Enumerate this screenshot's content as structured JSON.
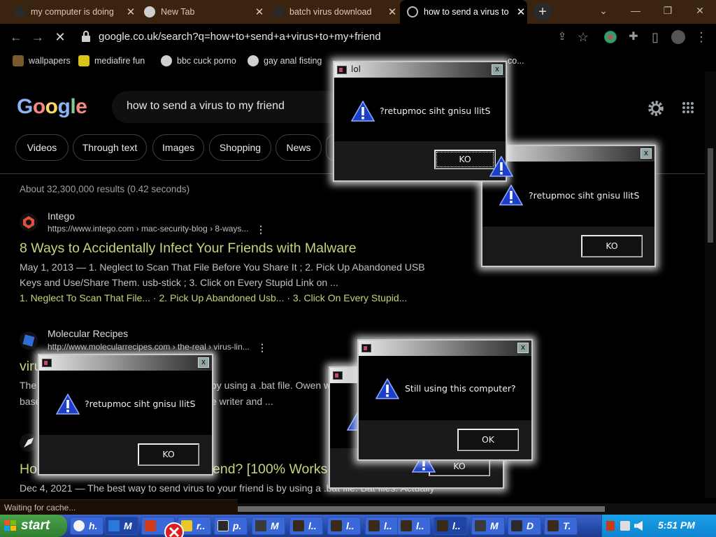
{
  "browser": {
    "tabs": [
      {
        "title": "my computer is doing",
        "close": "✕"
      },
      {
        "title": "New Tab",
        "close": "✕"
      },
      {
        "title": "batch virus download",
        "close": "✕"
      },
      {
        "title": "how to send a virus to",
        "close": "✕",
        "active": true
      }
    ],
    "new_tab": "+",
    "window_controls": {
      "tabsearch": "⌄",
      "minimize": "—",
      "restore": "❐",
      "close": "✕"
    },
    "nav": {
      "back": "←",
      "forward": "→",
      "reload": "✕",
      "share": "⇪",
      "star": "☆",
      "extensions": "✚",
      "sidebar": "▯",
      "menu": "⋮"
    },
    "url": "google.co.uk/search?q=how+to+send+a+virus+to+my+friend",
    "bookmarks": [
      {
        "label": "wallpapers",
        "color": "#7a5a2a"
      },
      {
        "label": "mediafire fun",
        "color": "#d8c31c"
      },
      {
        "label": "bbc cuck porno",
        "color": "#cfcfcf"
      },
      {
        "label": "gay anal fisting",
        "color": "#cfcfcf"
      },
      {
        "label": "co...",
        "color": "#cfcfcf"
      }
    ],
    "status": "Waiting for cache..."
  },
  "google": {
    "logo": [
      "G",
      "o",
      "o",
      "g",
      "l",
      "e"
    ],
    "logo_colors": [
      "#8ab4f8",
      "#f28b82",
      "#fdd663",
      "#8ab4f8",
      "#81c995",
      "#f28b82"
    ],
    "query": "how to send a virus to my friend",
    "chips": [
      "Videos",
      "Through text",
      "Images",
      "Shopping",
      "News"
    ],
    "stats": "About 32,300,000 results (0.42 seconds)",
    "results": [
      {
        "site": "Intego",
        "cite": "https://www.intego.com › mac-security-blog › 8-ways...",
        "title": "8 Ways to Accidentally Infect Your Friends with Malware",
        "snippet1": "May 1, 2013 — 1. Neglect to Scan That File Before You Share It ; 2. Pick Up Abandoned USB",
        "snippet2": "Keys and Use/Share Them. usb-stick ; 3. Click on Every Stupid Link on ...",
        "snippet3": "1. Neglect To Scan That File... · 2. Pick Up Abandoned Usb... · 3. Click On Every Stupid..."
      },
      {
        "site": "Molecular Recipes",
        "cite": "http://www.molecularrecipes.com › the-real › virus-lin...",
        "title_left": "viru",
        "snippet_left1": "The",
        "snippet_right1": "by using a .bat file. Owen w",
        "snippet_left2": "base",
        "snippet_right2": "e writer and ..."
      },
      {
        "title_left": "Ho",
        "title_right": "end? [100% Works",
        "snippet": "Dec 4, 2021 — The best way to send virus to your friend is by using a .bat file. Bat files. Actually"
      }
    ],
    "more": "⋮"
  },
  "dialogs": [
    {
      "title": "lol",
      "message": "?retupmoc siht gnisu llitS",
      "button": "KO",
      "close": "x"
    },
    {
      "title": "",
      "message": "?retupmoc siht gnisu llitS",
      "button": "KO",
      "close": "x"
    },
    {
      "title": "",
      "message": "?retupmoc siht gnisu llitS",
      "button": "KO",
      "close": "x"
    },
    {
      "title": "",
      "message": "",
      "button": "KO",
      "close": ""
    },
    {
      "title": "",
      "message": "Still using this computer?",
      "button": "OK",
      "close": "x"
    }
  ],
  "taskbar": {
    "start": "start",
    "tasks": [
      {
        "label": "h.",
        "color": "#f5f5f5"
      },
      {
        "label": "M",
        "color": "#2b78d8"
      },
      {
        "label": "",
        "color": "#d03c1c"
      },
      {
        "label": "r..",
        "color": "#e8c828"
      },
      {
        "label": "p.",
        "color": "#2a2a2a"
      },
      {
        "label": "M",
        "color": "#3a3a3a"
      },
      {
        "label": "l..",
        "color": "#3a2a1a"
      },
      {
        "label": "l..",
        "color": "#3a2a1a"
      },
      {
        "label": "l..",
        "color": "#3a2a1a"
      },
      {
        "label": "l..",
        "color": "#3a2a1a"
      },
      {
        "label": "l..",
        "color": "#3a2a1a"
      },
      {
        "label": "M",
        "color": "#3a3a3a"
      },
      {
        "label": "D",
        "color": "#2a2a2a"
      },
      {
        "label": "T.",
        "color": "#3a2a1a"
      }
    ],
    "clock": "5:51 PM"
  }
}
